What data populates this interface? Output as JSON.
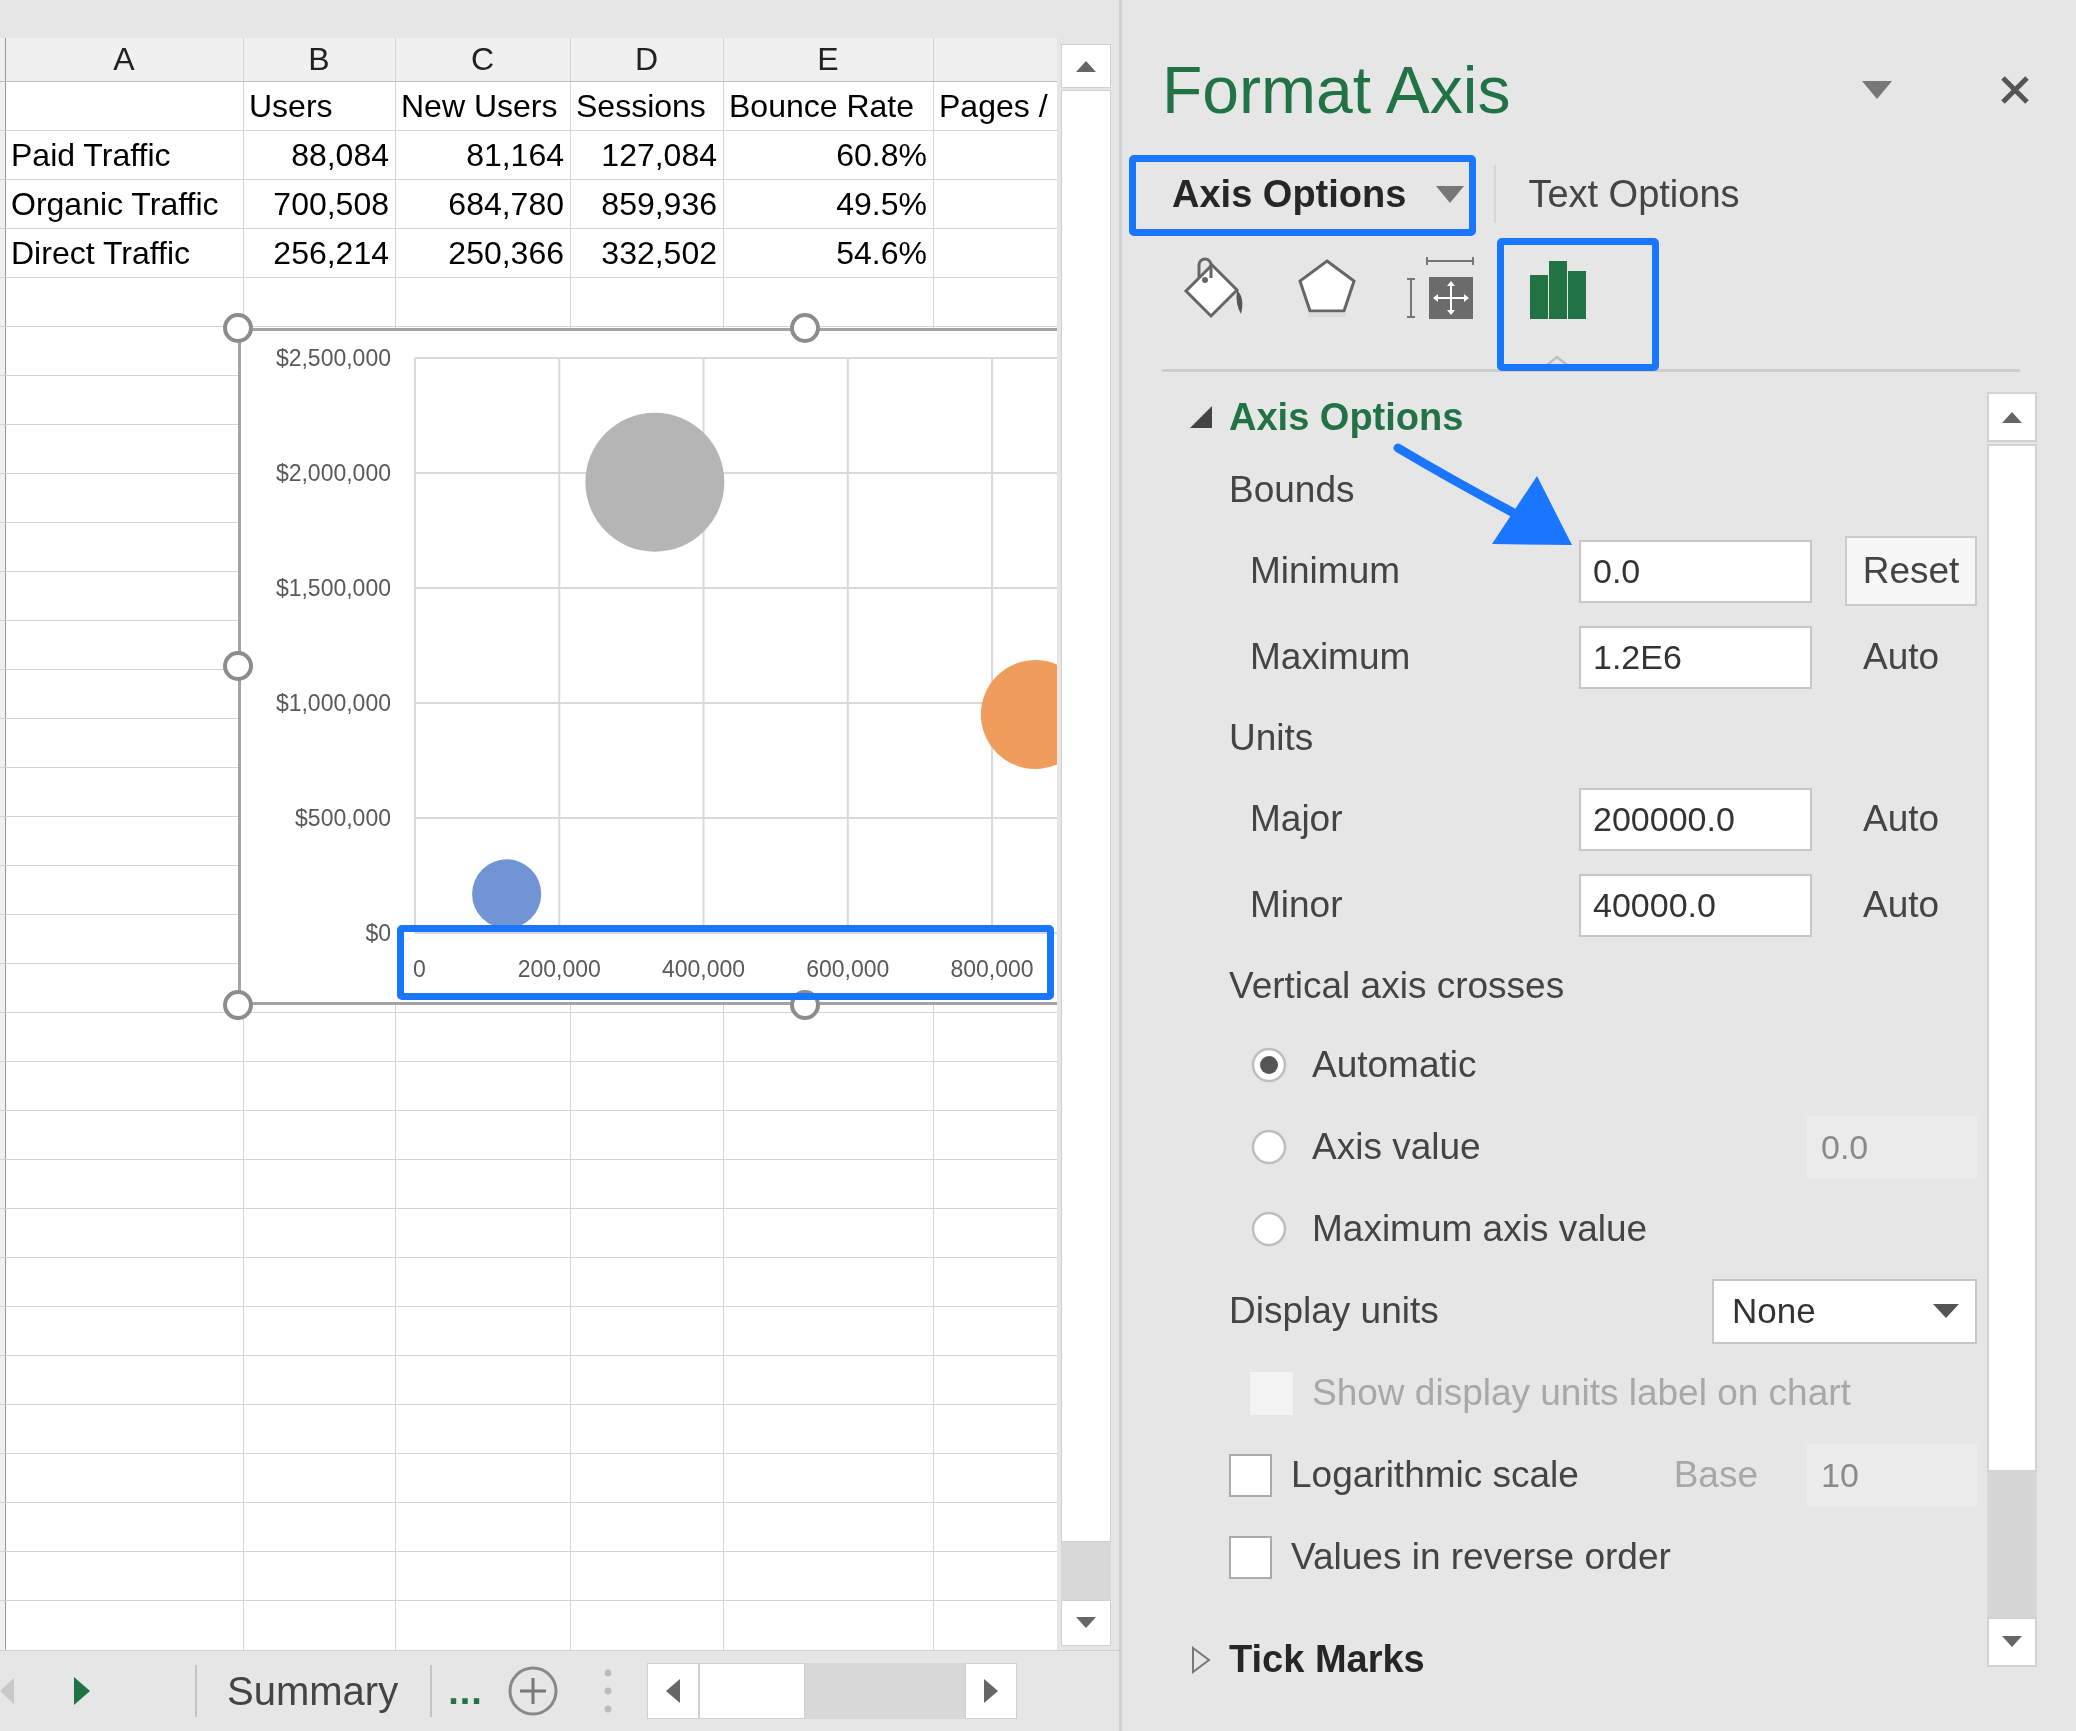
{
  "sheet": {
    "column_headers": [
      "A",
      "B",
      "C",
      "D",
      "E"
    ],
    "header_row": [
      "Users",
      "New Users",
      "Sessions",
      "Bounce Rate",
      "Pages /"
    ],
    "rows": [
      {
        "label": "Paid Traffic",
        "values": [
          "88,084",
          "81,164",
          "127,084",
          "60.8%"
        ]
      },
      {
        "label": "Organic Traffic",
        "values": [
          "700,508",
          "684,780",
          "859,936",
          "49.5%"
        ]
      },
      {
        "label": "Direct Traffic",
        "values": [
          "256,214",
          "250,366",
          "332,502",
          "54.6%"
        ]
      }
    ],
    "chart": {
      "chart_data": {
        "type": "scatter",
        "grid": true,
        "x": [
          127084,
          332502,
          859936
        ],
        "series": [
          {
            "color": "#7194d4",
            "values": [
              170000,
              null,
              null
            ]
          },
          {
            "color": "#b5b5b5",
            "values": [
              null,
              1960000,
              null
            ]
          },
          {
            "color": "#f09c5c",
            "values": [
              null,
              null,
              950000
            ]
          }
        ],
        "xlim": [
          0,
          890000
        ],
        "ylim": [
          0,
          2500000
        ],
        "xticks": [
          {
            "value": 0,
            "label": "0"
          },
          {
            "value": 200000,
            "label": "200,000"
          },
          {
            "value": 400000,
            "label": "400,000"
          },
          {
            "value": 600000,
            "label": "600,000"
          },
          {
            "value": 800000,
            "label": "800,000"
          }
        ],
        "yticks": [
          {
            "value": 0,
            "label": "$0"
          },
          {
            "value": 500000,
            "label": "$500,000"
          },
          {
            "value": 1000000,
            "label": "$1,000,000"
          },
          {
            "value": 1500000,
            "label": "$1,500,000"
          },
          {
            "value": 2000000,
            "label": "$2,000,000"
          },
          {
            "value": 2500000,
            "label": "$2,500,000"
          }
        ]
      }
    }
  },
  "sheet_tabs": {
    "tabs": [
      {
        "label": "Summary"
      }
    ],
    "overflow": "..."
  },
  "format_pane": {
    "title": "Format Axis",
    "tabs": [
      {
        "label": "Axis Options",
        "selected": true
      },
      {
        "label": "Text Options",
        "selected": false
      }
    ],
    "icon_tabs": [
      {
        "kind": "fill",
        "selected": false
      },
      {
        "kind": "effects",
        "selected": false
      },
      {
        "kind": "size",
        "selected": false
      },
      {
        "kind": "axis",
        "selected": true
      }
    ],
    "sections": [
      {
        "title": "Axis Options",
        "expanded": true,
        "items": [
          {
            "kind": "heading",
            "label": "Bounds",
            "children": [
              {
                "kind": "field",
                "label": "Minimum",
                "value": "0.0",
                "action": {
                  "kind": "button",
                  "label": "Reset"
                }
              },
              {
                "kind": "field",
                "label": "Maximum",
                "value": "1.2E6",
                "action": {
                  "kind": "text",
                  "label": "Auto"
                }
              }
            ]
          },
          {
            "kind": "heading",
            "label": "Units",
            "children": [
              {
                "kind": "field",
                "label": "Major",
                "value": "200000.0",
                "action": {
                  "kind": "text",
                  "label": "Auto"
                }
              },
              {
                "kind": "field",
                "label": "Minor",
                "value": "40000.0",
                "action": {
                  "kind": "text",
                  "label": "Auto"
                }
              }
            ]
          },
          {
            "kind": "heading",
            "label": "Vertical axis crosses",
            "children": [
              {
                "kind": "radio",
                "label": "Automatic",
                "selected": true
              },
              {
                "kind": "radio",
                "label": "Axis value",
                "selected": false,
                "field": {
                  "value": "0.0",
                  "disabled": true
                }
              },
              {
                "kind": "radio",
                "label": "Maximum axis value",
                "selected": false
              }
            ]
          },
          {
            "kind": "select",
            "label": "Display units",
            "value": "None",
            "children": [
              {
                "kind": "checkbox",
                "label": "Show display units label on chart",
                "checked": false,
                "disabled": true
              }
            ]
          },
          {
            "kind": "checkbox",
            "label": "Logarithmic scale",
            "checked": false,
            "disabled": false,
            "base": {
              "label": "Base",
              "value": "10",
              "disabled": true
            }
          },
          {
            "kind": "checkbox",
            "label": "Values in reverse order",
            "checked": false,
            "disabled": false
          }
        ]
      },
      {
        "title": "Tick Marks",
        "expanded": false
      }
    ]
  }
}
